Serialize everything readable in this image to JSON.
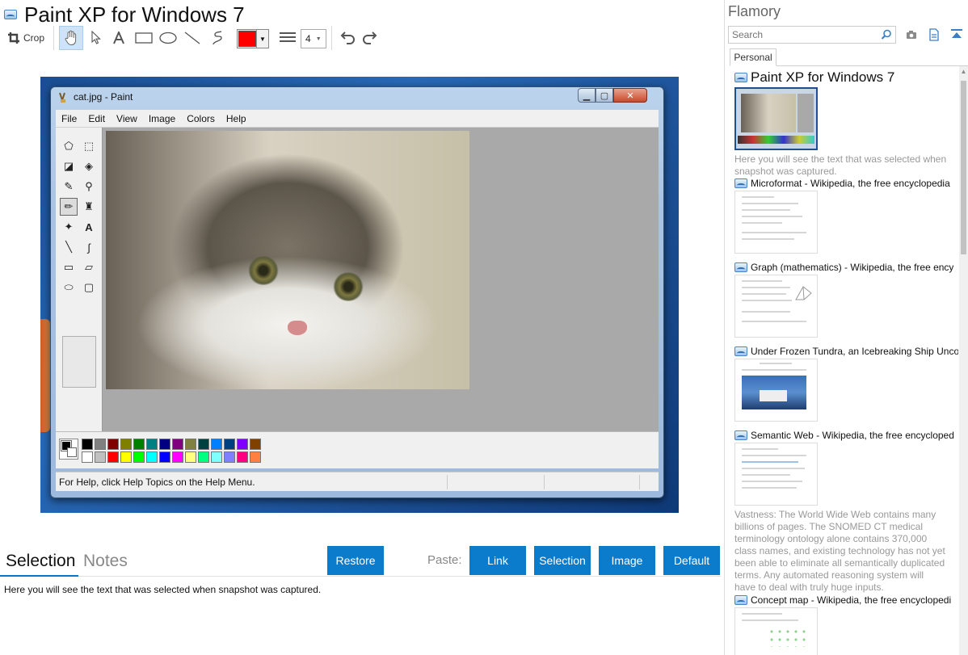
{
  "main": {
    "title": "Paint XP for Windows 7",
    "toolbar": {
      "crop_label": "Crop",
      "active_tool": "hand",
      "color": "#ff0000",
      "line_width": "4"
    },
    "snapshot": {
      "window_title": "cat.jpg - Paint",
      "menu": [
        "File",
        "Edit",
        "View",
        "Image",
        "Colors",
        "Help"
      ],
      "status": "For Help, click Help Topics on the Help Menu.",
      "palette_row1": [
        "#000000",
        "#808080",
        "#800000",
        "#808000",
        "#008000",
        "#008080",
        "#000080",
        "#800080",
        "#808040",
        "#004040",
        "#0080ff",
        "#004080",
        "#8000ff",
        "#804000"
      ],
      "palette_row2": [
        "#ffffff",
        "#c0c0c0",
        "#ff0000",
        "#ffff00",
        "#00ff00",
        "#00ffff",
        "#0000ff",
        "#ff00ff",
        "#ffff80",
        "#00ff80",
        "#80ffff",
        "#8080ff",
        "#ff0080",
        "#ff8040"
      ]
    },
    "tabs": {
      "selection": "Selection",
      "notes": "Notes"
    },
    "buttons": {
      "restore": "Restore",
      "paste_label": "Paste:",
      "link": "Link",
      "selection": "Selection",
      "image": "Image",
      "default": "Default"
    },
    "selection_text": "Here you will see the text that was selected when snapshot was captured."
  },
  "side": {
    "title": "Flamory",
    "search_placeholder": "Search",
    "tab": "Personal",
    "items": [
      {
        "title": "Paint XP for Windows 7",
        "desc": "Here you will see the text that was selected when snapshot was captured."
      },
      {
        "title": "Microformat - Wikipedia, the free encyclopedia",
        "desc": ""
      },
      {
        "title": "Graph (mathematics) - Wikipedia, the free ency",
        "desc": ""
      },
      {
        "title": "Under Frozen Tundra, an Icebreaking Ship Unco",
        "desc": ""
      },
      {
        "title": "Semantic Web - Wikipedia, the free encycloped",
        "desc": "Vastness: The World Wide Web contains many billions of pages. The SNOMED CT medical terminology ontology alone contains 370,000 class names, and existing technology has not yet been able to eliminate all semantically duplicated terms. Any automated reasoning system will have to deal with truly huge inputs."
      },
      {
        "title": "Concept map - Wikipedia, the free encyclopedi",
        "desc": ""
      }
    ]
  }
}
